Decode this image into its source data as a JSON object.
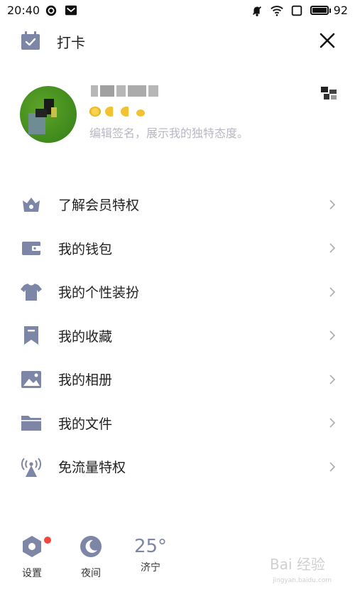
{
  "status_bar": {
    "time": "20:40",
    "battery": "92"
  },
  "header": {
    "checkin_label": "打卡"
  },
  "profile": {
    "signature": "编辑签名，展示我的独特态度。"
  },
  "menu": {
    "items": [
      {
        "label": "了解会员特权",
        "icon": "crown-icon"
      },
      {
        "label": "我的钱包",
        "icon": "wallet-icon"
      },
      {
        "label": "我的个性装扮",
        "icon": "tshirt-icon"
      },
      {
        "label": "我的收藏",
        "icon": "bookmark-icon"
      },
      {
        "label": "我的相册",
        "icon": "image-icon"
      },
      {
        "label": "我的文件",
        "icon": "folder-icon"
      },
      {
        "label": "免流量特权",
        "icon": "signal-tower-icon"
      }
    ]
  },
  "bottom_bar": {
    "settings_label": "设置",
    "night_label": "夜间",
    "weather_temp": "25°",
    "weather_city": "济宁"
  },
  "watermark": {
    "text": "Bai 经验",
    "url": "jingyan.baidu.com"
  },
  "colors": {
    "icon_gray": "#7d86a6",
    "badge_red": "#f2473f",
    "signature_gray": "#b8b8c4"
  }
}
